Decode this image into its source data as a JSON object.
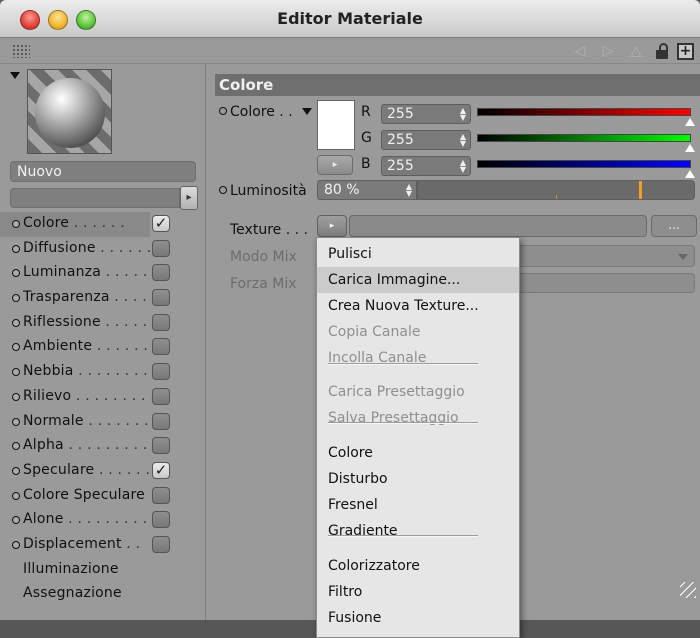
{
  "window": {
    "title": "Editor Materiale"
  },
  "material": {
    "name": "Nuovo"
  },
  "channels": [
    {
      "label": "Colore",
      "dots": " . . . . . .",
      "checked": true,
      "selected": true
    },
    {
      "label": "Diffusione",
      "dots": " . . . . . . .",
      "checked": false
    },
    {
      "label": "Luminanza",
      "dots": " . . . . .",
      "checked": false
    },
    {
      "label": "Trasparenza",
      "dots": " . . . .",
      "checked": false
    },
    {
      "label": "Riflessione",
      "dots": " . . . . .",
      "checked": false
    },
    {
      "label": "Ambiente",
      "dots": " . . . . . . .",
      "checked": false
    },
    {
      "label": "Nebbia",
      "dots": " . . . . . . . . .",
      "checked": false
    },
    {
      "label": "Rilievo",
      "dots": " . . . . . . . . .",
      "checked": false
    },
    {
      "label": "Normale",
      "dots": " . . . . . . .",
      "checked": false
    },
    {
      "label": "Alpha",
      "dots": " . . . . . . . . . .",
      "checked": false
    },
    {
      "label": "Speculare",
      "dots": " . . . . . .",
      "checked": true
    },
    {
      "label": "Colore Speculare",
      "dots": "",
      "checked": false
    },
    {
      "label": "Alone",
      "dots": " . . . . . . . . .",
      "checked": false
    },
    {
      "label": "Displacement",
      "dots": " . .",
      "checked": false
    }
  ],
  "extra_items": [
    "Illuminazione",
    "Assegnazione"
  ],
  "colore_section": {
    "header": "Colore",
    "color_label": "Colore . .",
    "swatch_color": "#ffffff",
    "r_label": "R",
    "r_value": "255",
    "g_label": "G",
    "g_value": "255",
    "b_label": "B",
    "b_value": "255",
    "luminosita_label": "Luminosità",
    "luminosita_value": "80 %",
    "luminosita_level": 0.8,
    "texture_label": "Texture . . .",
    "texture_more": "...",
    "modo_mix_label": "Modo Mix",
    "forza_mix_label": "Forza Mix"
  },
  "texture_menu": {
    "items": [
      {
        "label": "Pulisci",
        "enabled": true,
        "highlighted": false
      },
      {
        "label": "Carica Immagine...",
        "enabled": true,
        "highlighted": true
      },
      {
        "label": "Crea Nuova Texture...",
        "enabled": true,
        "highlighted": false
      },
      {
        "label": "Copia Canale",
        "enabled": false,
        "highlighted": false
      },
      {
        "label": "Incolla Canale",
        "enabled": false,
        "highlighted": false
      },
      {
        "label": "Carica Presettaggio",
        "enabled": false,
        "highlighted": false
      },
      {
        "label": "Salva Presettaggio",
        "enabled": false,
        "highlighted": false
      },
      {
        "label": "Colore",
        "enabled": true,
        "highlighted": false
      },
      {
        "label": "Disturbo",
        "enabled": true,
        "highlighted": false
      },
      {
        "label": "Fresnel",
        "enabled": true,
        "highlighted": false
      },
      {
        "label": "Gradiente",
        "enabled": true,
        "highlighted": false
      },
      {
        "label": "Colorizzatore",
        "enabled": true,
        "highlighted": false
      },
      {
        "label": "Filtro",
        "enabled": true,
        "highlighted": false
      },
      {
        "label": "Fusione",
        "enabled": true,
        "highlighted": false
      }
    ]
  },
  "icons": {
    "close": "close-button-icon",
    "minimize": "minimize-button-icon",
    "zoom": "zoom-button-icon",
    "lock": "lock-icon",
    "add": "plus-icon",
    "checkmark": "✓",
    "arrow": "▸"
  },
  "colors": {
    "red_channel": "#ff0000",
    "green_channel": "#00ff00",
    "blue_channel": "#0000ff",
    "luminosity_handle": "#f0a020"
  }
}
